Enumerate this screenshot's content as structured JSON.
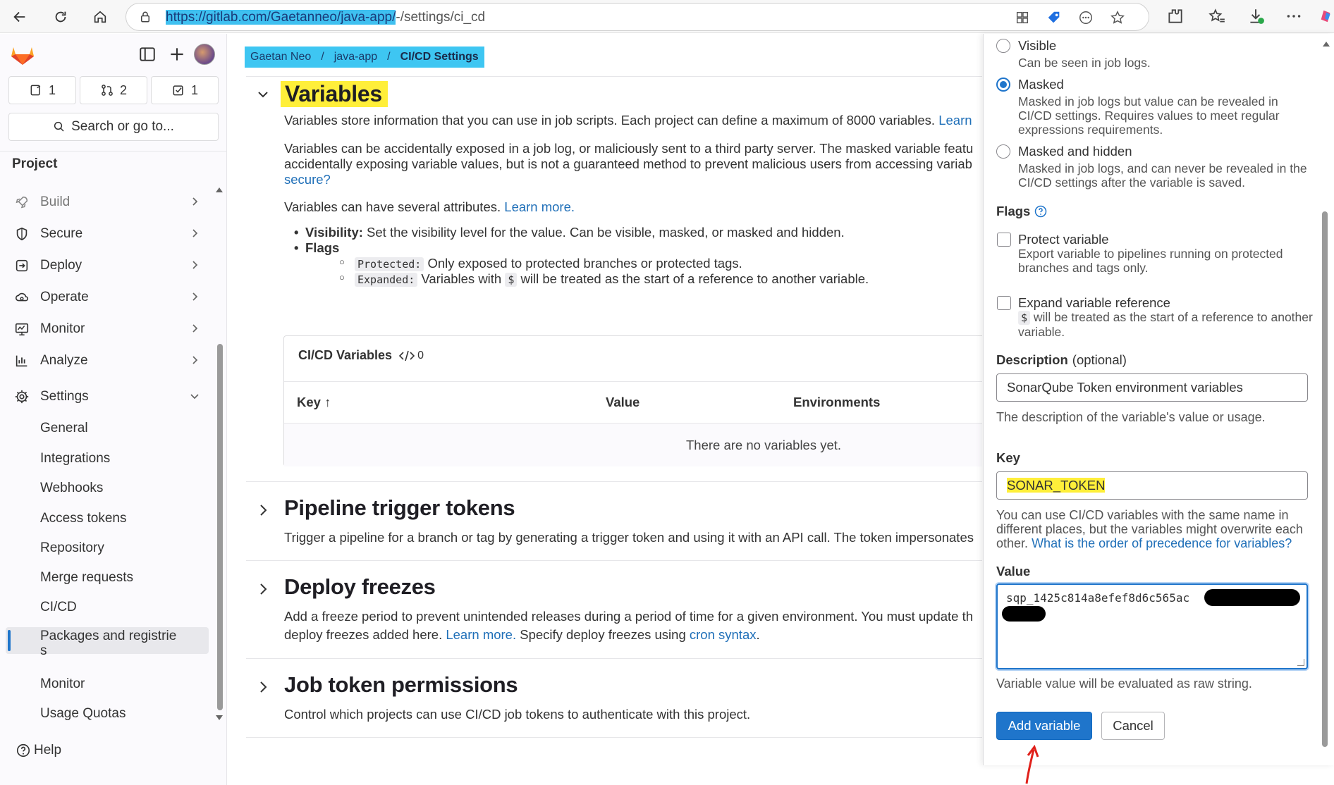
{
  "browser": {
    "url_selected": "https://gitlab.com/Gaetanneo/java-app/",
    "url_rest": "-/settings/ci_cd"
  },
  "sidebar": {
    "counters": [
      {
        "icon": "issues-icon",
        "value": "1"
      },
      {
        "icon": "merge-request-icon",
        "value": "2"
      },
      {
        "icon": "todo-icon",
        "value": "1"
      }
    ],
    "search_label": "Search or go to...",
    "section_label": "Project",
    "nav_items": [
      {
        "label": "Build",
        "icon": "rocket-icon"
      },
      {
        "label": "Secure",
        "icon": "shield-icon"
      },
      {
        "label": "Deploy",
        "icon": "deploy-icon"
      },
      {
        "label": "Operate",
        "icon": "cloud-gear-icon"
      },
      {
        "label": "Monitor",
        "icon": "monitor-icon"
      },
      {
        "label": "Analyze",
        "icon": "chart-icon"
      },
      {
        "label": "Settings",
        "icon": "gear-icon"
      }
    ],
    "settings_items": [
      "General",
      "Integrations",
      "Webhooks",
      "Access tokens",
      "Repository",
      "Merge requests",
      "CI/CD",
      "Packages and registrie",
      "s",
      "Monitor",
      "Usage Quotas"
    ],
    "help_label": "Help"
  },
  "breadcrumb": {
    "items": [
      "Gaetan Neo",
      "/",
      "java-app",
      "/",
      "CI/CD Settings"
    ]
  },
  "variables": {
    "title": "Variables",
    "intro": "Variables store information that you can use in job scripts. Each project can define a maximum of 8000 variables.",
    "intro_link": "Learn",
    "warning_line1": "Variables can be accidentally exposed in a job log, or maliciously sent to a third party server. The masked variable featu",
    "warning_line2": "accidentally exposing variable values, but is not a guaranteed method to prevent malicious users from accessing variab",
    "warning_link": "secure?",
    "attrs_text": "Variables can have several attributes.",
    "attrs_link": "Learn more.",
    "bullet_visibility_bold": "Visibility:",
    "bullet_visibility_text": "Set the visibility level for the value. Can be visible, masked, or masked and hidden.",
    "bullet_flags": "Flags",
    "flag_protected_code": "Protected:",
    "flag_protected_text": "Only exposed to protected branches or protected tags.",
    "flag_expanded_code": "Expanded:",
    "flag_expanded_pre": "Variables with",
    "flag_expanded_dollar": "$",
    "flag_expanded_post": "will be treated as the start of a reference to another variable.",
    "table_title": "CI/CD Variables",
    "table_count": "0",
    "col_key": "Key",
    "col_value": "Value",
    "col_env": "Environments",
    "empty_text": "There are no variables yet."
  },
  "sections": [
    {
      "title": "Pipeline trigger tokens",
      "desc": "Trigger a pipeline for a branch or tag by generating a trigger token and using it with an API call. The token impersonates"
    },
    {
      "title": "Deploy freezes",
      "desc1": "Add a freeze period to prevent unintended releases during a period of time for a given environment. You must update th",
      "desc2_pre": "deploy freezes added here.",
      "desc2_link1": "Learn more.",
      "desc2_mid": "Specify deploy freezes using",
      "desc2_link2": "cron syntax",
      "desc2_post": "."
    },
    {
      "title": "Job token permissions",
      "desc": "Control which projects can use CI/CD job tokens to authenticate with this project."
    }
  ],
  "drawer": {
    "visibility_options": [
      {
        "label": "Visible",
        "help": "Can be seen in job logs.",
        "checked": false
      },
      {
        "label": "Masked",
        "help": "Masked in job logs but value can be revealed in CI/CD settings. Requires values to meet regular expressions requirements.",
        "checked": true
      },
      {
        "label": "Masked and hidden",
        "help": "Masked in job logs, and can never be revealed in the CI/CD settings after the variable is saved.",
        "checked": false
      }
    ],
    "flags_label": "Flags",
    "protect_label": "Protect variable",
    "protect_help": "Export variable to pipelines running on protected branches and tags only.",
    "expand_label": "Expand variable reference",
    "expand_help_dollar": "$",
    "expand_help": "will be treated as the start of a reference to another variable.",
    "description_label": "Description",
    "description_optional": "(optional)",
    "description_value": "SonarQube Token environment variables",
    "description_help": "The description of the variable's value or usage.",
    "key_label": "Key",
    "key_value": "SONAR_TOKEN",
    "key_help": "You can use CI/CD variables with the same name in different places, but the variables might overwrite each other.",
    "key_help_link": "What is the order of precedence for variables?",
    "value_label": "Value",
    "value_text": "sqp_1425c814a8efef8d6c565ac",
    "value_help": "Variable value will be evaluated as raw string.",
    "add_button": "Add variable",
    "cancel_button": "Cancel"
  },
  "colors": {
    "primary": "#1f75cb",
    "highlight_yellow": "#ffef3a",
    "highlight_cyan": "#3ec6f2",
    "annotation_red": "#e0201a"
  }
}
